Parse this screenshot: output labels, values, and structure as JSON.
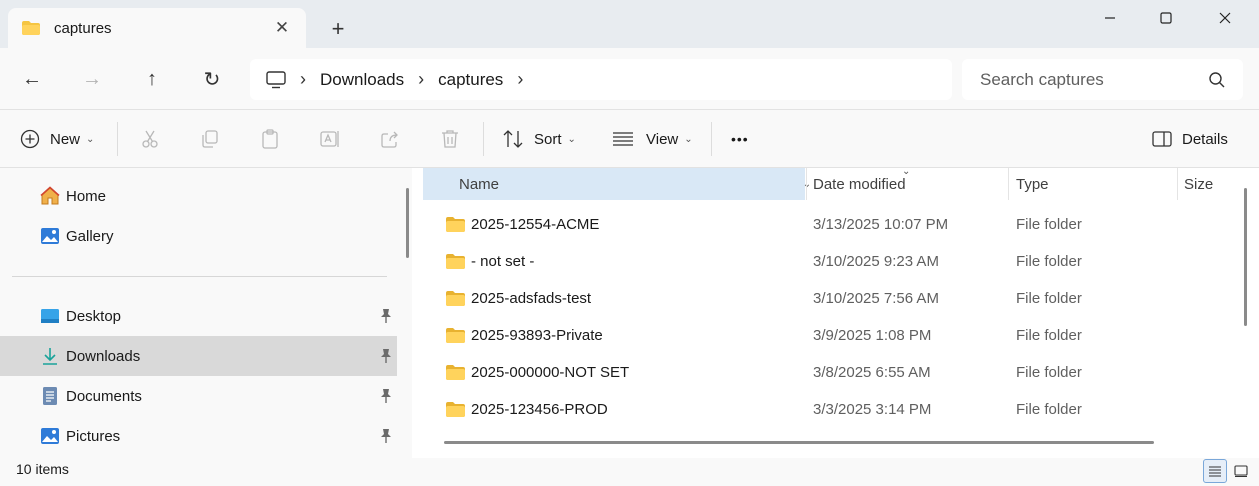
{
  "tab": {
    "title": "captures",
    "close_glyph": "✕",
    "new_tab_glyph": "+"
  },
  "window_controls": {
    "minimize": "—",
    "maximize": "☐",
    "close": "✕"
  },
  "nav": {
    "back": "←",
    "forward": "→",
    "up": "↑",
    "refresh": "↻"
  },
  "address": {
    "separator": "›",
    "crumbs": [
      "Downloads",
      "captures"
    ]
  },
  "search": {
    "placeholder": "Search captures"
  },
  "commands": {
    "new_label": "New",
    "sort_label": "Sort",
    "view_label": "View",
    "more_label": "•••",
    "details_label": "Details",
    "chevron": "⌄"
  },
  "sidebar": {
    "top_items": [
      {
        "label": "Home",
        "icon": "home-icon"
      },
      {
        "label": "Gallery",
        "icon": "gallery-icon"
      }
    ],
    "quick_access": [
      {
        "label": "Desktop",
        "icon": "desktop-icon",
        "pinned": true
      },
      {
        "label": "Downloads",
        "icon": "downloads-icon",
        "pinned": true,
        "selected": true
      },
      {
        "label": "Documents",
        "icon": "documents-icon",
        "pinned": true
      },
      {
        "label": "Pictures",
        "icon": "pictures-icon",
        "pinned": true
      }
    ]
  },
  "columns": {
    "name": "Name",
    "date": "Date modified",
    "type": "Type",
    "size": "Size"
  },
  "files": [
    {
      "name": "2025-12554-ACME",
      "date": "3/13/2025 10:07 PM",
      "type": "File folder"
    },
    {
      "name": "- not set -",
      "date": "3/10/2025 9:23 AM",
      "type": "File folder"
    },
    {
      "name": "2025-adsfads-test",
      "date": "3/10/2025 7:56 AM",
      "type": "File folder"
    },
    {
      "name": "2025-93893-Private",
      "date": "3/9/2025 1:08 PM",
      "type": "File folder"
    },
    {
      "name": "2025-000000-NOT SET",
      "date": "3/8/2025 6:55 AM",
      "type": "File folder"
    },
    {
      "name": "2025-123456-PROD",
      "date": "3/3/2025 3:14 PM",
      "type": "File folder"
    }
  ],
  "status": {
    "item_count": "10 items"
  },
  "colors": {
    "accent": "#0067c0",
    "folder": "#f5c542",
    "selected_row": "#d9e8f6"
  }
}
